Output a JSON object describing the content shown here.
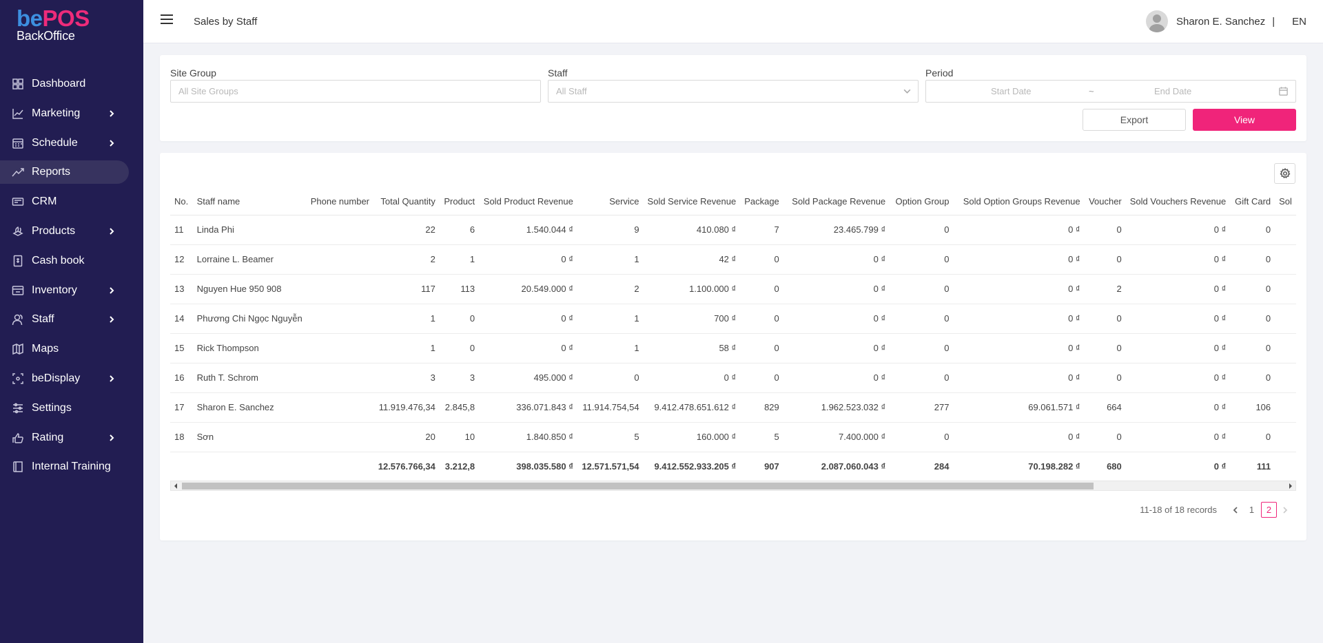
{
  "brand": {
    "logo_be": "be",
    "logo_pos": "POS",
    "logo_sub": "BackOffice",
    "accent_color": "#f0247a",
    "sidebar_color": "#221d52"
  },
  "sidebar": {
    "items": [
      {
        "label": "Dashboard",
        "icon": "grid-icon",
        "has_submenu": false,
        "active": false
      },
      {
        "label": "Marketing",
        "icon": "line-chart-icon",
        "has_submenu": true,
        "active": false
      },
      {
        "label": "Schedule",
        "icon": "calendar-icon",
        "has_submenu": true,
        "active": false
      },
      {
        "label": "Reports",
        "icon": "trend-icon",
        "has_submenu": false,
        "active": true
      },
      {
        "label": "CRM",
        "icon": "card-icon",
        "has_submenu": false,
        "active": false
      },
      {
        "label": "Products",
        "icon": "products-icon",
        "has_submenu": true,
        "active": false
      },
      {
        "label": "Cash book",
        "icon": "cash-book-icon",
        "has_submenu": false,
        "active": false
      },
      {
        "label": "Inventory",
        "icon": "inventory-icon",
        "has_submenu": true,
        "active": false
      },
      {
        "label": "Staff",
        "icon": "staff-icon",
        "has_submenu": true,
        "active": false
      },
      {
        "label": "Maps",
        "icon": "map-icon",
        "has_submenu": false,
        "active": false
      },
      {
        "label": "beDisplay",
        "icon": "display-icon",
        "has_submenu": true,
        "active": false
      },
      {
        "label": "Settings",
        "icon": "sliders-icon",
        "has_submenu": false,
        "active": false
      },
      {
        "label": "Rating",
        "icon": "rating-icon",
        "has_submenu": true,
        "active": false
      },
      {
        "label": "Internal Training",
        "icon": "book-icon",
        "has_submenu": false,
        "active": false
      }
    ]
  },
  "header": {
    "title": "Sales by Staff",
    "user_name": "Sharon E. Sanchez",
    "separator": "|",
    "language": "EN"
  },
  "filters": {
    "site_group_label": "Site Group",
    "site_group_placeholder": "All Site Groups",
    "staff_label": "Staff",
    "staff_placeholder": "All Staff",
    "period_label": "Period",
    "start_placeholder": "Start Date",
    "tilde": "~",
    "end_placeholder": "End Date",
    "export_label": "Export",
    "view_label": "View"
  },
  "table": {
    "columns": [
      "No.",
      "Staff name",
      "Phone number",
      "Total Quantity",
      "Product",
      "Sold Product Revenue",
      "Service",
      "Sold Service Revenue",
      "Package",
      "Sold Package Revenue",
      "Option Group",
      "Sold Option Groups Revenue",
      "Voucher",
      "Sold Vouchers Revenue",
      "Gift Card",
      "Sol"
    ],
    "rows": [
      [
        "11",
        "Linda Phi",
        "",
        "22",
        "6",
        "1.540.044 ₫",
        "9",
        "410.080 ₫",
        "7",
        "23.465.799 ₫",
        "0",
        "0 ₫",
        "0",
        "0 ₫",
        "0",
        ""
      ],
      [
        "12",
        "Lorraine L. Beamer",
        "",
        "2",
        "1",
        "0 ₫",
        "1",
        "42 ₫",
        "0",
        "0 ₫",
        "0",
        "0 ₫",
        "0",
        "0 ₫",
        "0",
        ""
      ],
      [
        "13",
        "Nguyen Hue 950 908",
        "",
        "117",
        "113",
        "20.549.000 ₫",
        "2",
        "1.100.000 ₫",
        "0",
        "0 ₫",
        "0",
        "0 ₫",
        "2",
        "0 ₫",
        "0",
        ""
      ],
      [
        "14",
        "Phương Chi Ngọc Nguyễn",
        "",
        "1",
        "0",
        "0 ₫",
        "1",
        "700 ₫",
        "0",
        "0 ₫",
        "0",
        "0 ₫",
        "0",
        "0 ₫",
        "0",
        ""
      ],
      [
        "15",
        "Rick Thompson",
        "",
        "1",
        "0",
        "0 ₫",
        "1",
        "58 ₫",
        "0",
        "0 ₫",
        "0",
        "0 ₫",
        "0",
        "0 ₫",
        "0",
        ""
      ],
      [
        "16",
        "Ruth T. Schrom",
        "",
        "3",
        "3",
        "495.000 ₫",
        "0",
        "0 ₫",
        "0",
        "0 ₫",
        "0",
        "0 ₫",
        "0",
        "0 ₫",
        "0",
        ""
      ],
      [
        "17",
        "Sharon E. Sanchez",
        "",
        "11.919.476,34",
        "2.845,8",
        "336.071.843 ₫",
        "11.914.754,54",
        "9.412.478.651.612 ₫",
        "829",
        "1.962.523.032 ₫",
        "277",
        "69.061.571 ₫",
        "664",
        "0 ₫",
        "106",
        ""
      ],
      [
        "18",
        "Sơn",
        "",
        "20",
        "10",
        "1.840.850 ₫",
        "5",
        "160.000 ₫",
        "5",
        "7.400.000 ₫",
        "0",
        "0 ₫",
        "0",
        "0 ₫",
        "0",
        ""
      ]
    ],
    "totals": [
      "",
      "",
      "",
      "12.576.766,34",
      "3.212,8",
      "398.035.580 ₫",
      "12.571.571,54",
      "9.412.552.933.205 ₫",
      "907",
      "2.087.060.043 ₫",
      "284",
      "70.198.282 ₫",
      "680",
      "0 ₫",
      "111",
      ""
    ]
  },
  "pagination": {
    "range_text": "11-18 of 18 records",
    "pages": [
      "1",
      "2"
    ],
    "current_page": "2"
  }
}
